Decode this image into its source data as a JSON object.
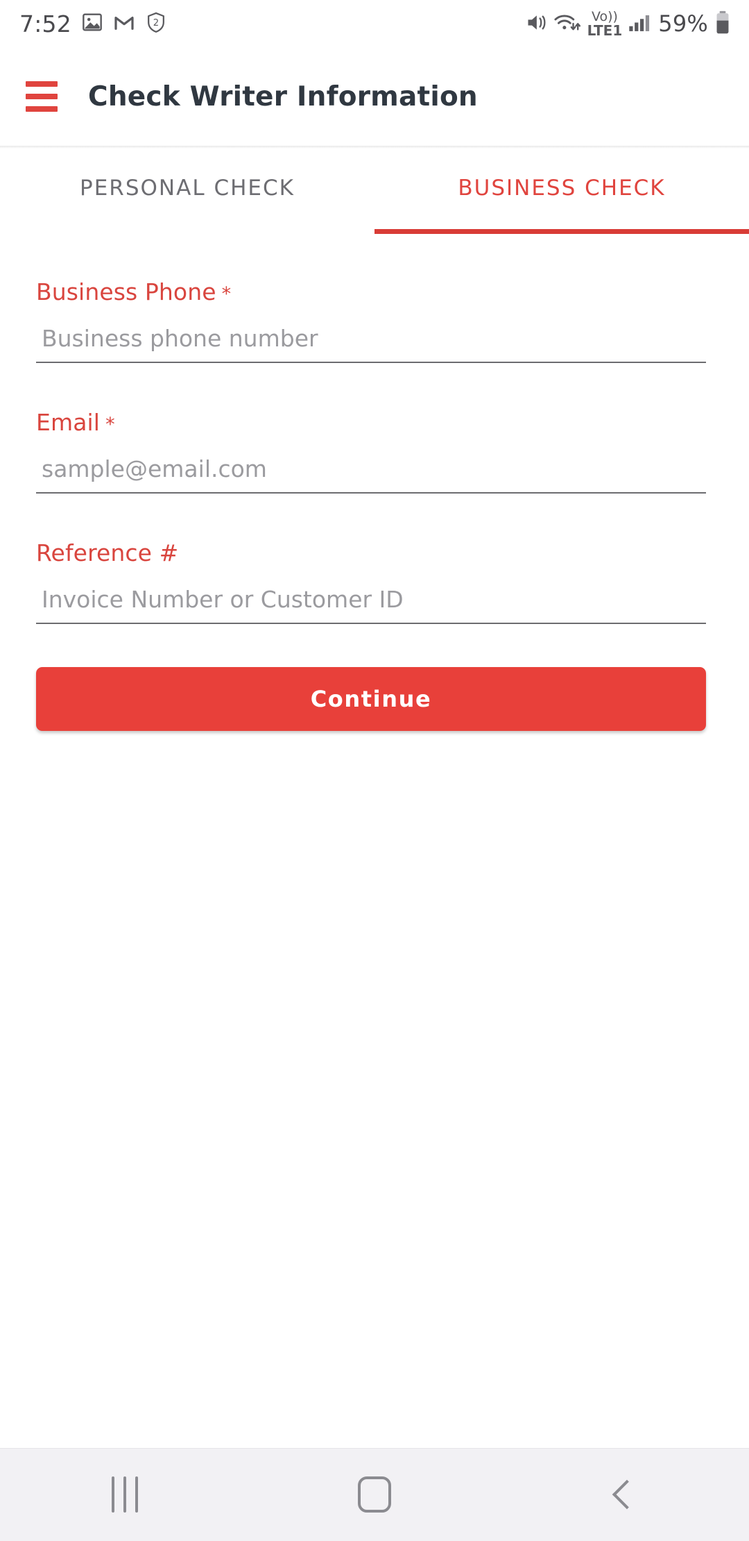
{
  "status_bar": {
    "time": "7:52",
    "battery_percent": "59%",
    "network_label_top": "Vo))",
    "network_label_bottom": "LTE1",
    "shield_badge": "2",
    "icons": [
      "photo-icon",
      "gmail-icon",
      "shield-badge-icon",
      "mute-vibrate-icon",
      "wifi-icon",
      "volte-icon",
      "signal-bars-icon",
      "battery-icon"
    ]
  },
  "appbar": {
    "menu_icon": "hamburger-menu-icon",
    "title": "Check Writer Information"
  },
  "tabs": [
    {
      "label": "PERSONAL CHECK",
      "active": false
    },
    {
      "label": "BUSINESS CHECK",
      "active": true
    }
  ],
  "form": {
    "fields": [
      {
        "label": "Business Phone",
        "required_marker": "*",
        "placeholder": "Business phone number",
        "value": ""
      },
      {
        "label": "Email",
        "required_marker": "*",
        "placeholder": "sample@email.com",
        "value": ""
      },
      {
        "label": "Reference #",
        "required_marker": "",
        "placeholder": "Invoice Number or Customer ID",
        "value": ""
      }
    ],
    "submit_label": "Continue"
  },
  "nav_bar": {
    "recents_label": "recents-icon",
    "home_label": "home-icon",
    "back_label": "back-icon"
  },
  "colors": {
    "accent_red": "#e0443e",
    "button_red": "#e8403a",
    "tab_underline": "#d93c36",
    "title_dark": "#303841",
    "placeholder_gray": "#9b9b9f",
    "nav_bg": "#f2f1f4"
  }
}
